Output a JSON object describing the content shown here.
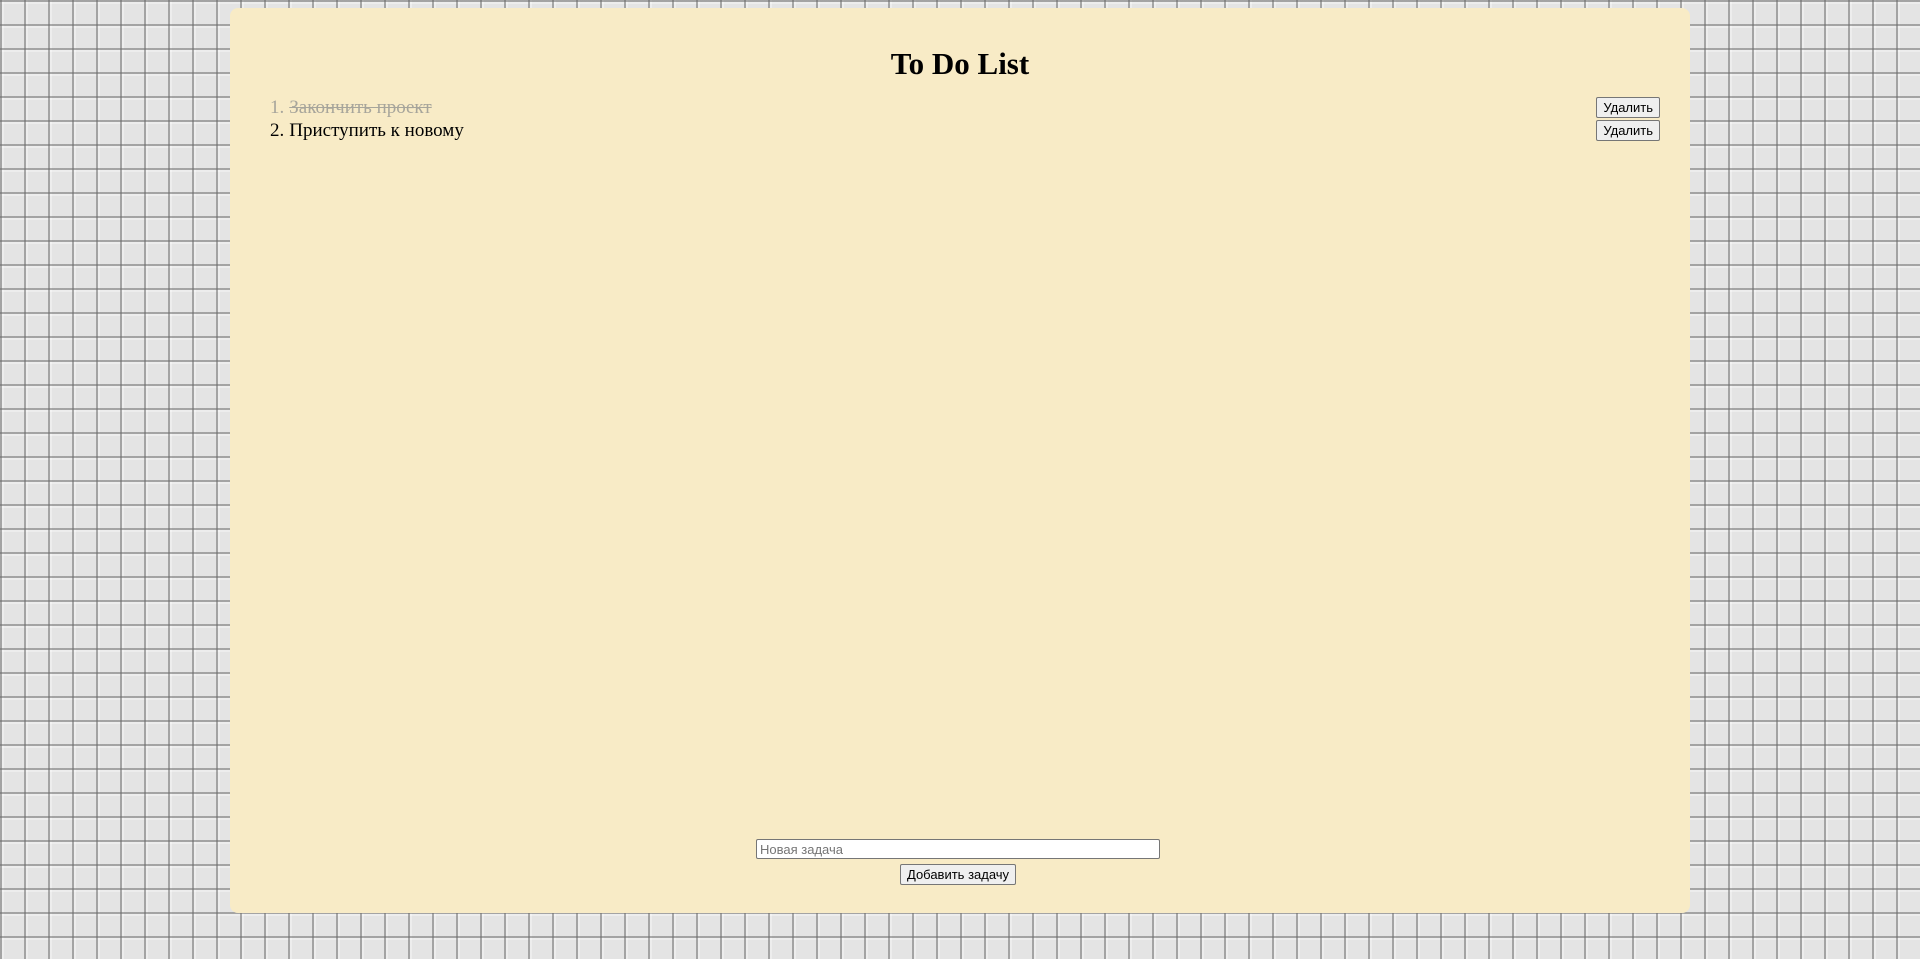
{
  "app": {
    "title": "To Do List"
  },
  "tasks": [
    {
      "number": "1.",
      "text": "Закончить проект",
      "done": true,
      "delete_label": "Удалить"
    },
    {
      "number": "2.",
      "text": "Приступить к новому",
      "done": false,
      "delete_label": "Удалить"
    }
  ],
  "form": {
    "input_value": "",
    "input_placeholder": "Новая задача",
    "add_label": "Добавить задачу"
  }
}
